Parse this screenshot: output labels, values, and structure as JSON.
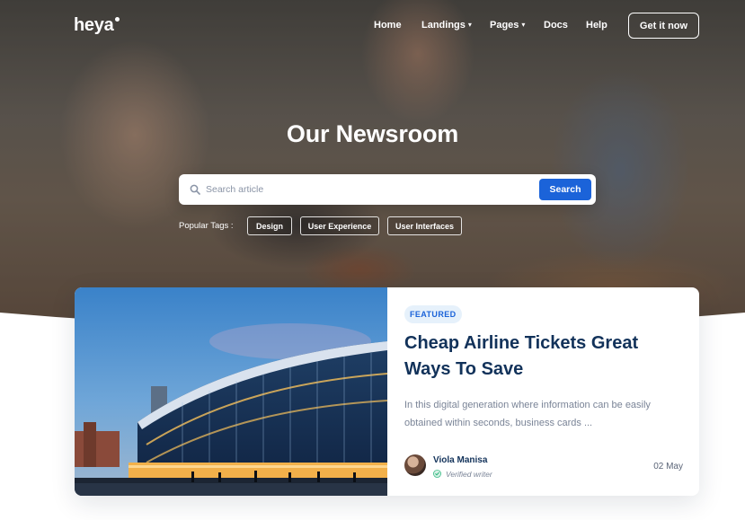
{
  "brand": {
    "logo_text": "heya"
  },
  "nav": {
    "links": [
      {
        "label": "Home",
        "has_dropdown": false
      },
      {
        "label": "Landings",
        "has_dropdown": true
      },
      {
        "label": "Pages",
        "has_dropdown": true
      },
      {
        "label": "Docs",
        "has_dropdown": false
      },
      {
        "label": "Help",
        "has_dropdown": false
      }
    ],
    "cta_label": "Get it now"
  },
  "hero": {
    "title": "Our Newsroom"
  },
  "search": {
    "placeholder": "Search article",
    "value": "",
    "button_label": "Search"
  },
  "tags": {
    "label": "Popular Tags :",
    "items": [
      "Design",
      "User Experience",
      "User Interfaces"
    ]
  },
  "featured_post": {
    "badge": "FEATURED",
    "title": "Cheap Airline Tickets Great Ways To Save",
    "excerpt": "In this digital generation where information can be easily obtained within seconds, business cards ...",
    "author": {
      "name": "Viola Manisa",
      "role": "Verified writer"
    },
    "date": "02 May"
  },
  "colors": {
    "primary": "#1b63d9",
    "heading": "#12325a",
    "muted": "#7a8497",
    "badge_bg": "#e6f1fb",
    "verified": "#27b57a"
  }
}
